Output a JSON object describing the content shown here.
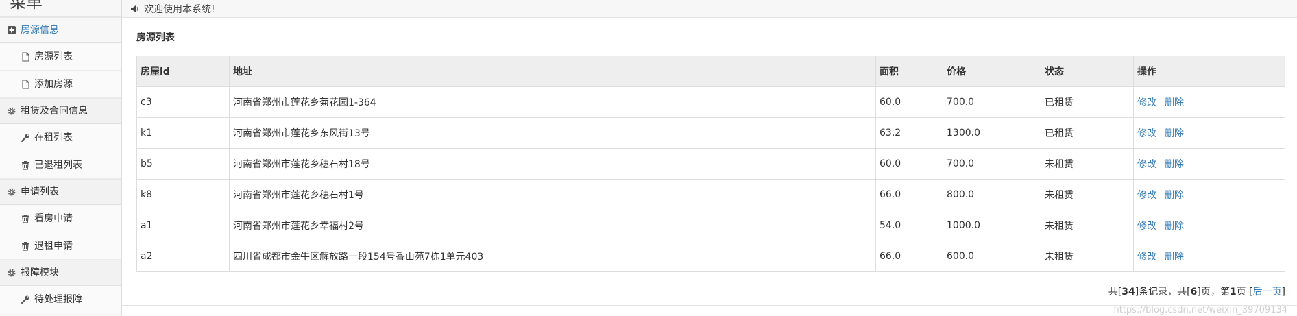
{
  "sidebar": {
    "title": "菜单",
    "sections": [
      {
        "label": "房源信息",
        "items": [
          "房源列表",
          "添加房源"
        ]
      },
      {
        "label": "租赁及合同信息",
        "items": [
          "在租列表",
          "已退租列表"
        ]
      },
      {
        "label": "申请列表",
        "items": [
          "看房申请",
          "退租申请"
        ]
      },
      {
        "label": "报障模块",
        "items": [
          "待处理报障"
        ]
      }
    ]
  },
  "topbar": {
    "notice": "欢迎使用本系统!"
  },
  "main": {
    "title": "房源列表",
    "columns": [
      "房屋id",
      "地址",
      "面积",
      "价格",
      "状态",
      "操作"
    ],
    "rows": [
      {
        "id": "c3",
        "address": "河南省郑州市莲花乡菊花园1-364",
        "area": "60.0",
        "price": "700.0",
        "status": "已租赁"
      },
      {
        "id": "k1",
        "address": "河南省郑州市莲花乡东风街13号",
        "area": "63.2",
        "price": "1300.0",
        "status": "已租赁"
      },
      {
        "id": "b5",
        "address": "河南省郑州市莲花乡穗石村18号",
        "area": "60.0",
        "price": "700.0",
        "status": "未租赁"
      },
      {
        "id": "k8",
        "address": "河南省郑州市莲花乡穗石村1号",
        "area": "66.0",
        "price": "800.0",
        "status": "未租赁"
      },
      {
        "id": "a1",
        "address": "河南省郑州市莲花乡幸福村2号",
        "area": "54.0",
        "price": "1000.0",
        "status": "未租赁"
      },
      {
        "id": "a2",
        "address": "四川省成都市金牛区解放路一段154号香山苑7栋1单元403",
        "area": "66.0",
        "price": "600.0",
        "status": "未租赁"
      }
    ],
    "actions": {
      "edit": "修改",
      "delete": "删除"
    },
    "pagination": {
      "prefix": "共[",
      "total": "34",
      "mid1": "]条记录，共[",
      "pages": "6",
      "mid2": "]页，第",
      "current": "1",
      "mid3": "页 [",
      "next": "后一页",
      "suffix": "]"
    }
  },
  "watermark": "https://blog.csdn.net/weixin_39709134",
  "colors": {
    "link": "#337ab7",
    "header_bg": "#eeeeee",
    "sidebar_bg": "#f7f7f7"
  },
  "icons": {
    "sections": [
      "plus-square-icon",
      "gear-icon",
      "gear-icon",
      "gear-icon"
    ],
    "items": [
      "file-icon",
      "file-icon",
      "wrench-icon",
      "trash-icon",
      "trash-icon",
      "trash-icon",
      "wrench-icon"
    ]
  }
}
